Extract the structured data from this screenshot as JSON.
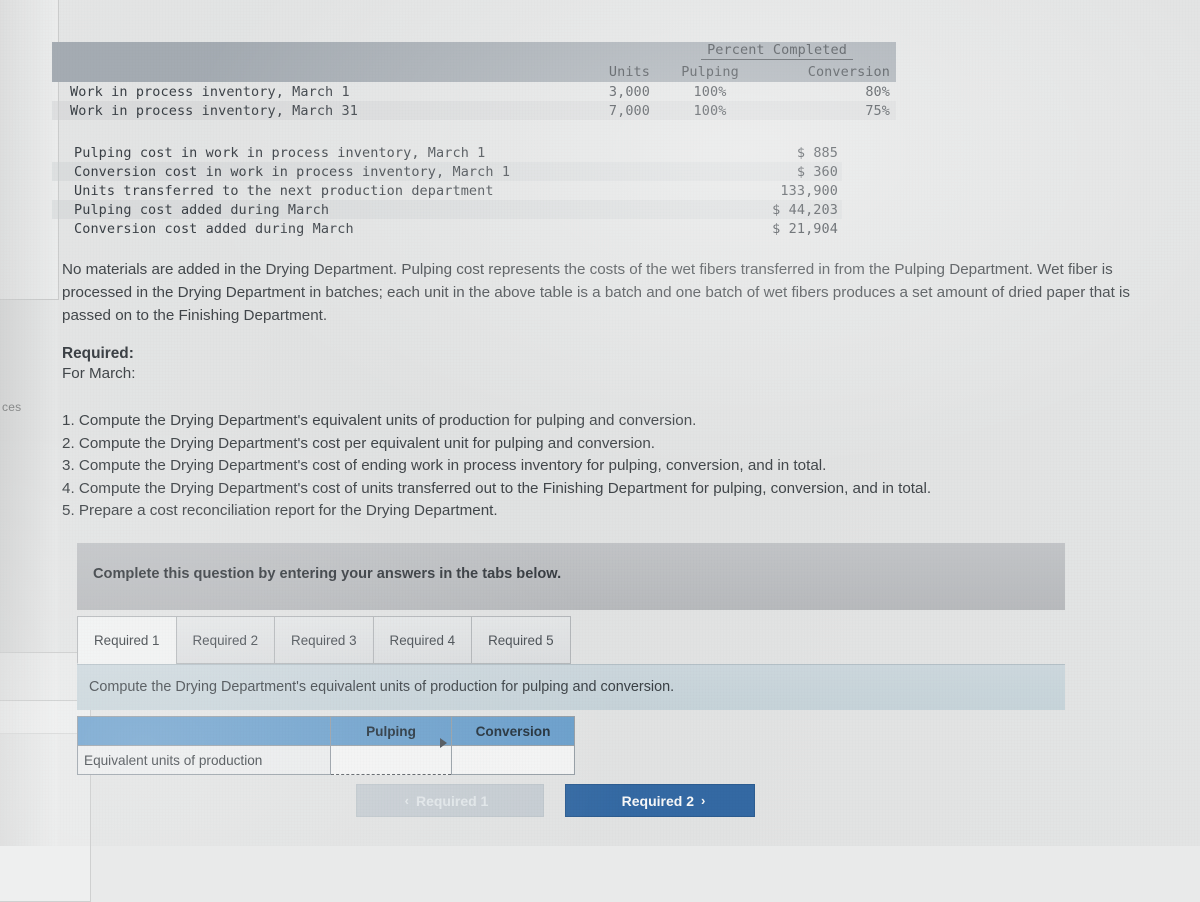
{
  "left_panel": {
    "cut_label": "ces"
  },
  "summary_table": {
    "col_group_header": "Percent Completed",
    "columns": [
      "Units",
      "Pulping",
      "Conversion"
    ],
    "rows": [
      {
        "label": "Work in process inventory, March 1",
        "units": "3,000",
        "pulping": "100%",
        "conversion": "80%"
      },
      {
        "label": "Work in process inventory, March 31",
        "units": "7,000",
        "pulping": "100%",
        "conversion": "75%"
      }
    ]
  },
  "cost_table": {
    "rows": [
      {
        "label": "Pulping cost in work in process inventory, March 1",
        "value": "$ 885"
      },
      {
        "label": "Conversion cost in work in process inventory, March 1",
        "value": "$ 360"
      },
      {
        "label": "Units transferred to the next production department",
        "value": "133,900"
      },
      {
        "label": "Pulping cost added during March",
        "value": "$ 44,203"
      },
      {
        "label": "Conversion cost added during March",
        "value": "$ 21,904"
      }
    ]
  },
  "narrative": "No materials are added in the Drying Department. Pulping cost represents the costs of the wet fibers transferred in from the Pulping Department. Wet fiber is processed in the Drying Department in batches; each unit in the above table is a batch and one batch of wet fibers produces a set amount of dried paper that is passed on to the Finishing Department.",
  "required": {
    "heading": "Required:",
    "subheading": "For March:",
    "items": [
      "1. Compute the Drying Department's equivalent units of production for pulping and conversion.",
      "2. Compute the Drying Department's cost per equivalent unit for pulping and conversion.",
      "3. Compute the Drying Department's cost of ending work in process inventory for pulping, conversion, and in total.",
      "4. Compute the Drying Department's cost of units transferred out to the Finishing Department for pulping, conversion, and in total.",
      "5. Prepare a cost reconciliation report for the Drying Department."
    ]
  },
  "instruction_banner": "Complete this question by entering your answers in the tabs below.",
  "tabs": [
    {
      "label": "Required 1",
      "active": true
    },
    {
      "label": "Required 2",
      "active": false
    },
    {
      "label": "Required 3",
      "active": false
    },
    {
      "label": "Required 4",
      "active": false
    },
    {
      "label": "Required 5",
      "active": false
    }
  ],
  "question_prompt": "Compute the Drying Department's equivalent units of production for pulping and conversion.",
  "answer_table": {
    "blank_header": "",
    "headers": [
      "Pulping",
      "Conversion"
    ],
    "row_label": "Equivalent units of production",
    "pulping_value": "",
    "conversion_value": ""
  },
  "nav": {
    "prev_chevron": "‹",
    "prev_label": "Required 1",
    "next_label": "Required 2",
    "next_chevron": "›"
  },
  "colors": {
    "page_background": "#eceded",
    "table_header_gray": "#a8afb6",
    "instruction_banner_gray": "#c2c4c7",
    "question_banner_blue": "#ccd9df",
    "answer_header_blue": "#6ea4d2",
    "next_button_blue": "#356ca8",
    "prev_button_gray": "#ccd3d9",
    "text": "#43484c"
  }
}
